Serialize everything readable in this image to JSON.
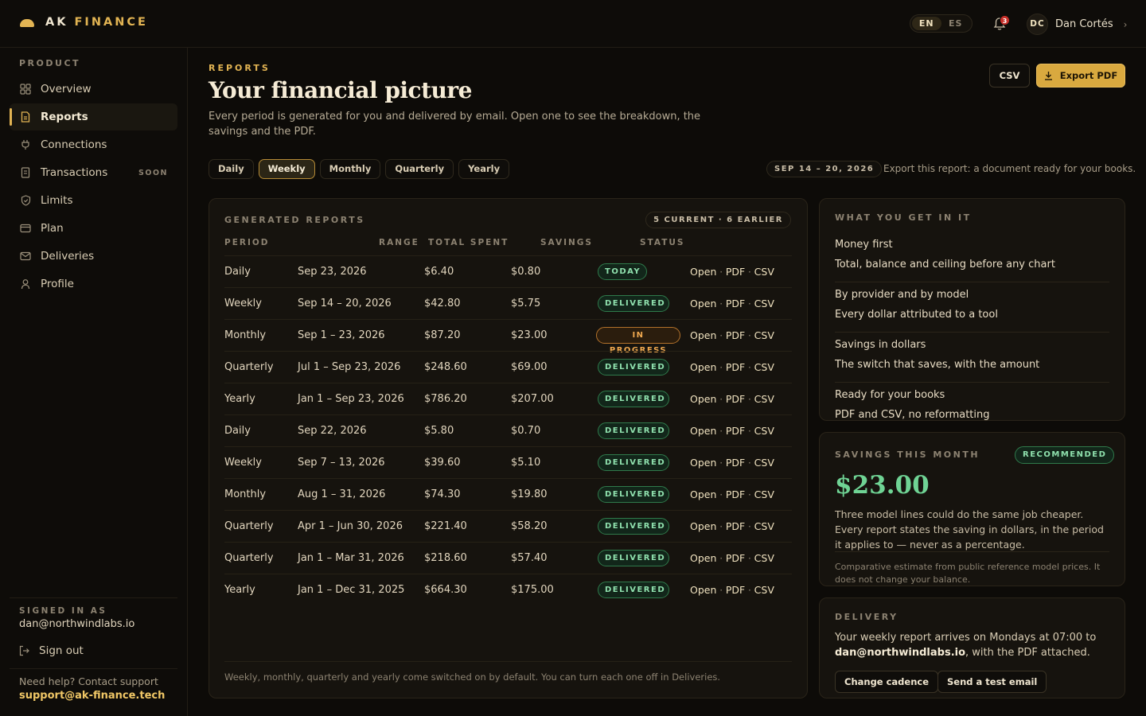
{
  "brand": {
    "name_a": "AK",
    "name_b": "FINANCE"
  },
  "header": {
    "languages": [
      "EN",
      "ES"
    ],
    "notifications_count": "3",
    "user": {
      "initials": "DC",
      "name": "Dan Cortés"
    }
  },
  "sidebar": {
    "section": "PRODUCT",
    "items": [
      {
        "label": "Overview",
        "icon": "grid-icon"
      },
      {
        "label": "Reports",
        "icon": "document-icon",
        "active": true
      },
      {
        "label": "Connections",
        "icon": "plug-icon"
      },
      {
        "label": "Transactions",
        "icon": "receipt-icon",
        "badge": "SOON"
      },
      {
        "label": "Limits",
        "icon": "shield-icon"
      },
      {
        "label": "Plan",
        "icon": "card-icon"
      },
      {
        "label": "Deliveries",
        "icon": "mail-icon"
      },
      {
        "label": "Profile",
        "icon": "person-icon"
      }
    ],
    "signed_in_label": "SIGNED IN AS",
    "signed_in_email": "dan@northwindlabs.io",
    "sign_out": "Sign out",
    "help_text": "Need help? Contact support",
    "help_email": "support@ak-finance.tech"
  },
  "main": {
    "eyebrow": "REPORTS",
    "title": "Your financial picture",
    "subtitle": "Every period is generated for you and delivered by email. Open one to see the breakdown, the savings and the PDF.",
    "csv_button": "CSV",
    "export_button": "Export PDF",
    "tabs": [
      "Daily",
      "Weekly",
      "Monthly",
      "Quarterly",
      "Yearly"
    ],
    "active_tab": "Weekly",
    "period_pill": "SEP 14 – 20, 2026",
    "export_hint": "Export this report: a document ready for your books."
  },
  "reports": {
    "title": "GENERATED REPORTS",
    "count": "5 CURRENT · 6 EARLIER",
    "columns": [
      "PERIOD",
      "RANGE",
      "TOTAL SPENT",
      "SAVINGS",
      "STATUS"
    ],
    "actions": [
      "Open",
      "PDF",
      "CSV"
    ],
    "rows": [
      {
        "period": "Daily",
        "range": "Sep 23, 2026",
        "total": "$6.40",
        "savings": "$0.80",
        "status": "TODAY",
        "kind": "today"
      },
      {
        "period": "Weekly",
        "range": "Sep 14 – 20, 2026",
        "total": "$42.80",
        "savings": "$5.75",
        "status": "DELIVERED",
        "kind": "delivered"
      },
      {
        "period": "Monthly",
        "range": "Sep 1 – 23, 2026",
        "total": "$87.20",
        "savings": "$23.00",
        "status": "IN PROGRESS",
        "kind": "progress"
      },
      {
        "period": "Quarterly",
        "range": "Jul 1 – Sep 23, 2026",
        "total": "$248.60",
        "savings": "$69.00",
        "status": "DELIVERED",
        "kind": "delivered"
      },
      {
        "period": "Yearly",
        "range": "Jan 1 – Sep 23, 2026",
        "total": "$786.20",
        "savings": "$207.00",
        "status": "DELIVERED",
        "kind": "delivered"
      },
      {
        "period": "Daily",
        "range": "Sep 22, 2026",
        "total": "$5.80",
        "savings": "$0.70",
        "status": "DELIVERED",
        "kind": "delivered"
      },
      {
        "period": "Weekly",
        "range": "Sep 7 – 13, 2026",
        "total": "$39.60",
        "savings": "$5.10",
        "status": "DELIVERED",
        "kind": "delivered"
      },
      {
        "period": "Monthly",
        "range": "Aug 1 – 31, 2026",
        "total": "$74.30",
        "savings": "$19.80",
        "status": "DELIVERED",
        "kind": "delivered"
      },
      {
        "period": "Quarterly",
        "range": "Apr 1 – Jun 30, 2026",
        "total": "$221.40",
        "savings": "$58.20",
        "status": "DELIVERED",
        "kind": "delivered"
      },
      {
        "period": "Quarterly",
        "range": "Jan 1 – Mar 31, 2026",
        "total": "$218.60",
        "savings": "$57.40",
        "status": "DELIVERED",
        "kind": "delivered"
      },
      {
        "period": "Yearly",
        "range": "Jan 1 – Dec 31, 2025",
        "total": "$664.30",
        "savings": "$175.00",
        "status": "DELIVERED",
        "kind": "delivered"
      }
    ],
    "note": "Weekly, monthly, quarterly and yearly come switched on by default. You can turn each one off in Deliveries."
  },
  "features": {
    "title": "WHAT YOU GET IN IT",
    "items": [
      {
        "title": "Money first",
        "desc": "Total, balance and ceiling before any chart"
      },
      {
        "title": "By provider and by model",
        "desc": "Every dollar attributed to a tool"
      },
      {
        "title": "Savings in dollars",
        "desc": "The switch that saves, with the amount"
      },
      {
        "title": "Ready for your books",
        "desc": "PDF and CSV, no reformatting"
      }
    ]
  },
  "savings": {
    "title": "SAVINGS THIS MONTH",
    "badge": "RECOMMENDED",
    "amount": "$23.00",
    "desc": "Three model lines could do the same job cheaper. Every report states the saving in dollars, in the period it applies to — never as a percentage.",
    "note": "Comparative estimate from public reference model prices. It does not change your balance."
  },
  "delivery": {
    "title": "DELIVERY",
    "text_before": "Your weekly report arrives on Mondays at 07:00 to",
    "email": "dan@northwindlabs.io",
    "text_after": ", with the PDF attached.",
    "change_button": "Change cadence",
    "test_button": "Send a test email"
  },
  "colors": {
    "accent": "#e2b453",
    "background": "#0d0b08",
    "card": "#16130e",
    "success": "#6fd394",
    "warning": "#f0a950"
  }
}
